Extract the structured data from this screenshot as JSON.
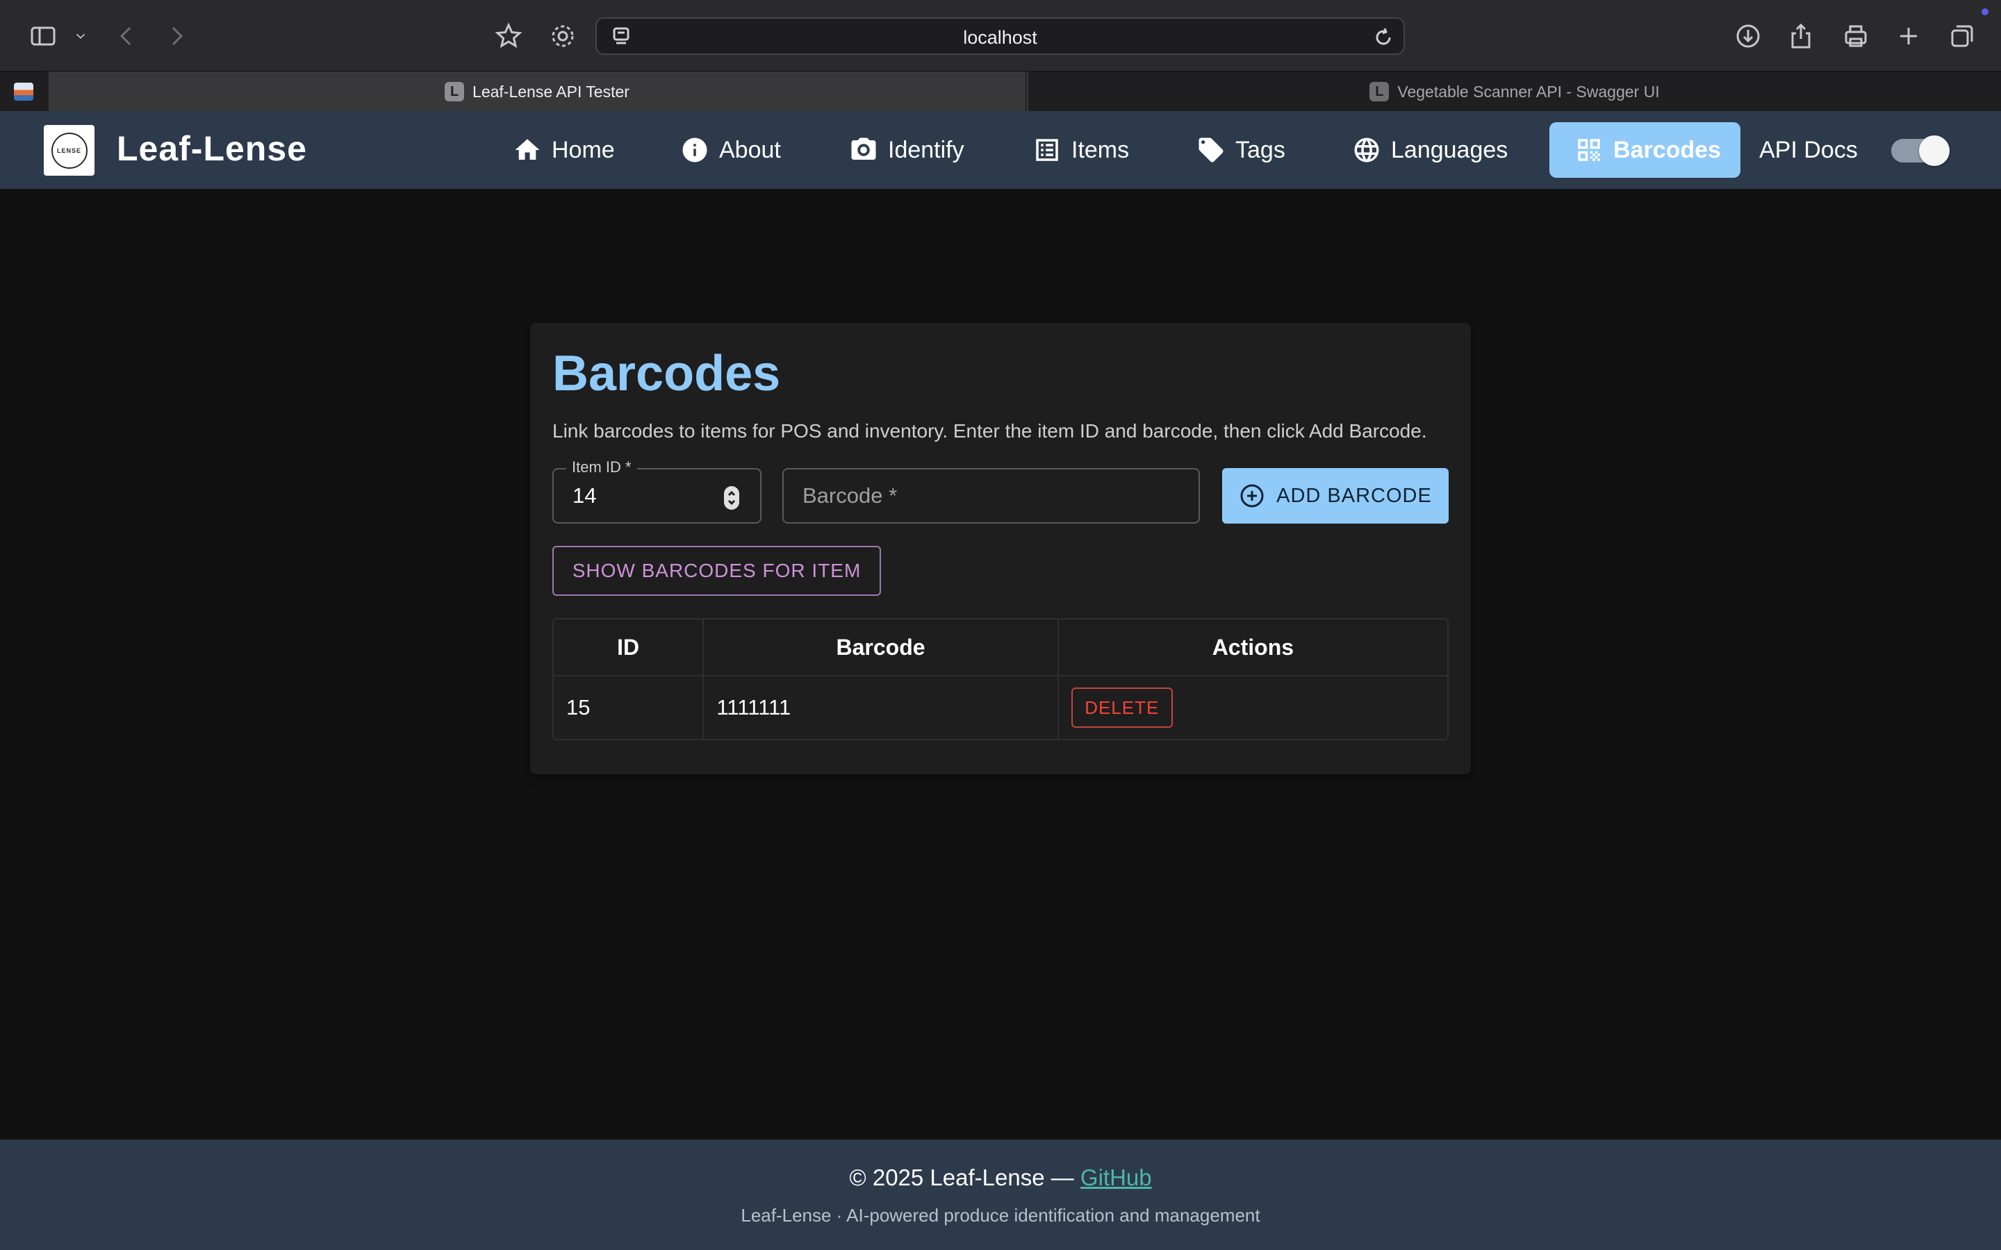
{
  "browser": {
    "url": "localhost",
    "tabs": [
      {
        "favicon": "L",
        "title": "Leaf-Lense API Tester"
      },
      {
        "favicon": "L",
        "title": "Vegetable Scanner API - Swagger UI"
      }
    ]
  },
  "header": {
    "brand": "Leaf-Lense",
    "logo_text": "LENSE",
    "nav": [
      {
        "label": "Home",
        "icon": "home-icon"
      },
      {
        "label": "About",
        "icon": "info-icon"
      },
      {
        "label": "Identify",
        "icon": "camera-icon"
      },
      {
        "label": "Items",
        "icon": "list-icon"
      },
      {
        "label": "Tags",
        "icon": "tag-icon"
      },
      {
        "label": "Languages",
        "icon": "globe-icon"
      },
      {
        "label": "Barcodes",
        "icon": "qr-code-icon",
        "active": true
      },
      {
        "label": "API Docs"
      }
    ],
    "theme_toggle_on": true
  },
  "barcodes": {
    "title": "Barcodes",
    "description": "Link barcodes to items for POS and inventory. Enter the item ID and barcode, then click Add Barcode.",
    "item_id_label": "Item ID *",
    "item_id_value": "14",
    "barcode_placeholder": "Barcode *",
    "add_button": "ADD BARCODE",
    "show_button": "SHOW BARCODES FOR ITEM",
    "table": {
      "columns": [
        "ID",
        "Barcode",
        "Actions"
      ],
      "rows": [
        {
          "id": "15",
          "barcode": "1111111",
          "action": "DELETE"
        }
      ]
    }
  },
  "footer": {
    "copyright": "© 2025 Leaf-Lense —",
    "link": "GitHub",
    "tagline": "Leaf-Lense · AI-powered produce identification and management"
  },
  "colors": {
    "accent": "#90caf9",
    "header_bg": "#2d3a4b",
    "secondary": "#ce93d8",
    "danger": "#f44336",
    "link": "#4db6ac"
  }
}
